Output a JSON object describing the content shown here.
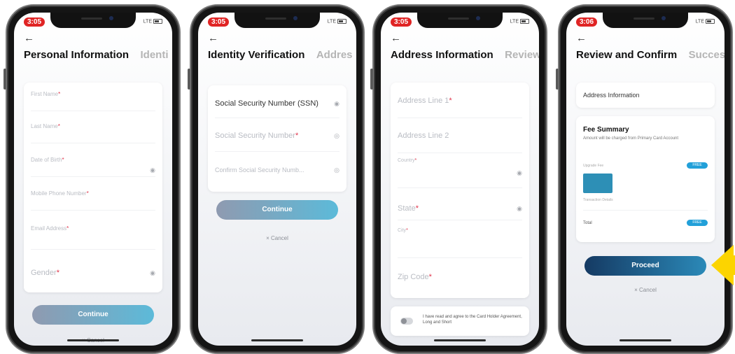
{
  "status_bar": {
    "times": [
      "3:05",
      "3:05",
      "3:05",
      "3:06"
    ],
    "signal": "LTE"
  },
  "common": {
    "back_icon": "arrow-left-icon",
    "cancel_label": "× Cancel"
  },
  "screen1": {
    "title": "Personal Information",
    "next_title": "Identi",
    "fields": [
      {
        "label": "First Name",
        "required": "*"
      },
      {
        "label": "Last Name",
        "required": "*"
      },
      {
        "label": "Date of Birth",
        "required": "*"
      },
      {
        "label": "Mobile Phone Number",
        "required": "*"
      },
      {
        "label": "Email Address",
        "required": "*"
      },
      {
        "label": "Gender",
        "required": "*"
      }
    ],
    "button": "Continue"
  },
  "screen2": {
    "title": "Identity Verification",
    "next_title": "Addres",
    "fields": [
      {
        "label": "Social Security Number (SSN)"
      },
      {
        "label": "Social Security Number",
        "required": "*"
      },
      {
        "label": "Confirm Social Security Numb..."
      }
    ],
    "button": "Continue"
  },
  "screen3": {
    "title": "Address Information",
    "next_title": "Review",
    "fields": [
      {
        "label": "Address Line 1",
        "required": "*"
      },
      {
        "label": "Address Line 2"
      },
      {
        "label": "Country",
        "required": "*"
      },
      {
        "label": "State",
        "required": "*"
      },
      {
        "label": "City",
        "required": "*"
      },
      {
        "label": "Zip Code",
        "required": "*"
      }
    ],
    "agreement": "I have read and agree to the Card Holder Agreement, Long and Short"
  },
  "screen4": {
    "title": "Review and Confirm",
    "next_title": "Succes",
    "section": "Address Information",
    "fee_title": "Fee Summary",
    "fee_desc": "Amount will be charged from Primary Card Account",
    "fee_row1": "Upgrade Fee",
    "fee_badge1": "FREE",
    "fee_row2": "Transaction Details",
    "total_label": "Total",
    "total_badge": "FREE",
    "button": "Proceed"
  },
  "colors": {
    "accent_gradient_start": "#8f9ab0",
    "accent_gradient_end": "#5cbad9",
    "proceed_start": "#153a63",
    "proceed_end": "#2b89b8",
    "required": "#e0334a",
    "highlight_arrow": "#fcd400"
  }
}
